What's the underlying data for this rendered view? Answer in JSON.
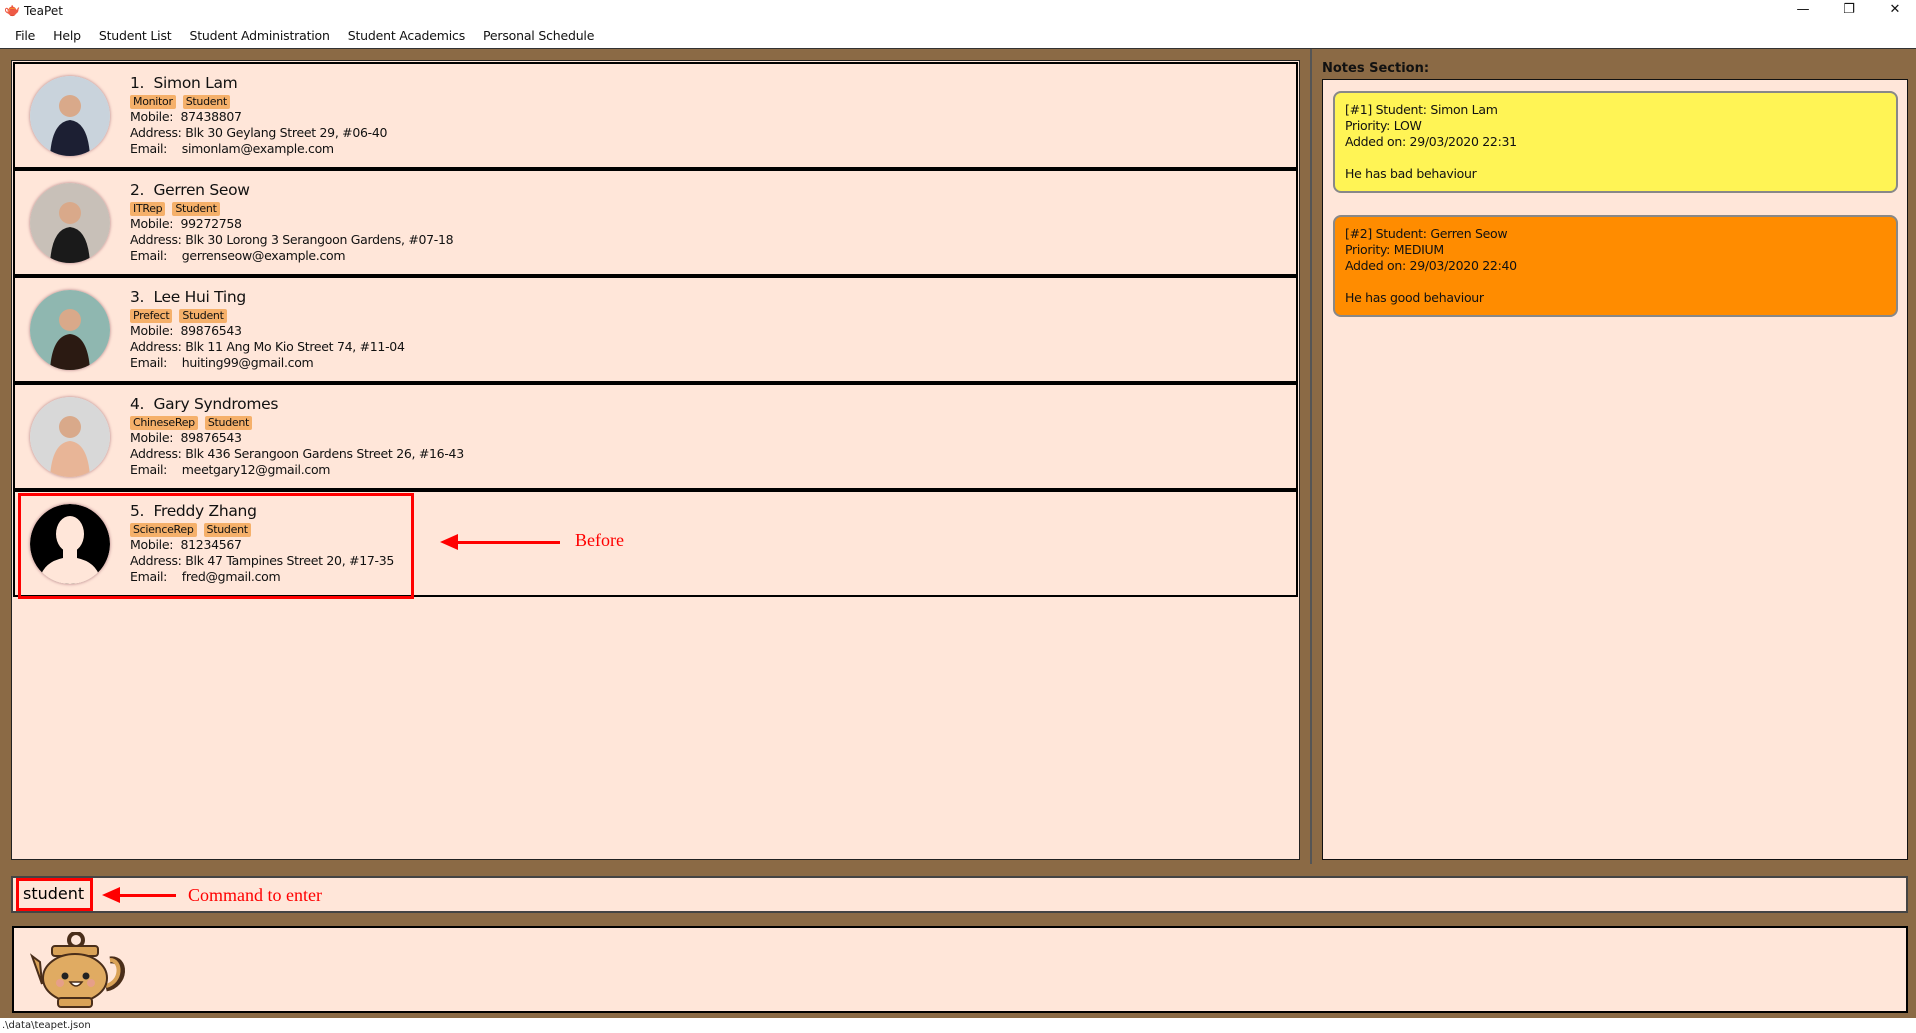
{
  "window": {
    "title": "TeaPet",
    "minimize": "—",
    "restore": "❐",
    "close": "✕"
  },
  "menu": [
    "File",
    "Help",
    "Student List",
    "Student Administration",
    "Student Academics",
    "Personal Schedule"
  ],
  "students": [
    {
      "index": "1.",
      "name": "Simon Lam",
      "tags": [
        "Monitor",
        "Student"
      ],
      "mobile_label": "Mobile:",
      "mobile": "87438807",
      "address_label": "Address:",
      "address": "Blk 30 Geylang Street 29, #06-40",
      "email_label": "Email:",
      "email": "simonlam@example.com"
    },
    {
      "index": "2.",
      "name": "Gerren Seow",
      "tags": [
        "ITRep",
        "Student"
      ],
      "mobile_label": "Mobile:",
      "mobile": "99272758",
      "address_label": "Address:",
      "address": "Blk 30 Lorong 3 Serangoon Gardens, #07-18",
      "email_label": "Email:",
      "email": "gerrenseow@example.com"
    },
    {
      "index": "3.",
      "name": "Lee Hui Ting",
      "tags": [
        "Prefect",
        "Student"
      ],
      "mobile_label": "Mobile:",
      "mobile": "89876543",
      "address_label": "Address:",
      "address": "Blk 11 Ang Mo Kio Street 74, #11-04",
      "email_label": "Email:",
      "email": "huiting99@gmail.com"
    },
    {
      "index": "4.",
      "name": "Gary Syndromes",
      "tags": [
        "ChineseRep",
        "Student"
      ],
      "mobile_label": "Mobile:",
      "mobile": "89876543",
      "address_label": "Address:",
      "address": "Blk 436 Serangoon Gardens Street 26, #16-43",
      "email_label": "Email:",
      "email": "meetgary12@gmail.com"
    },
    {
      "index": "5.",
      "name": "Freddy Zhang",
      "tags": [
        "ScienceRep",
        "Student"
      ],
      "mobile_label": "Mobile:",
      "mobile": "81234567",
      "address_label": "Address:",
      "address": "Blk 47 Tampines Street 20, #17-35",
      "email_label": "Email:",
      "email": "fred@gmail.com"
    }
  ],
  "annotations": {
    "before": "Before",
    "command": "Command to enter"
  },
  "notes": {
    "label": "Notes Section:",
    "items": [
      {
        "header": "[#1] Student: Simon Lam",
        "priority": "Priority: LOW",
        "added": "Added on: 29/03/2020 22:31",
        "content": "He has bad behaviour",
        "color": "#FFF455"
      },
      {
        "header": "[#2] Student: Gerren Seow",
        "priority": "Priority: MEDIUM",
        "added": "Added on: 29/03/2020 22:40",
        "content": "He has good behaviour",
        "color": "#FF8C00"
      }
    ]
  },
  "command": {
    "value": "student"
  },
  "status": {
    "path": ".\\data\\teapet.json"
  },
  "colors": {
    "background": "#8B6A45",
    "panel": "#FFE6D9",
    "tag": "#F5B06A",
    "annotation": "#FF0000"
  }
}
